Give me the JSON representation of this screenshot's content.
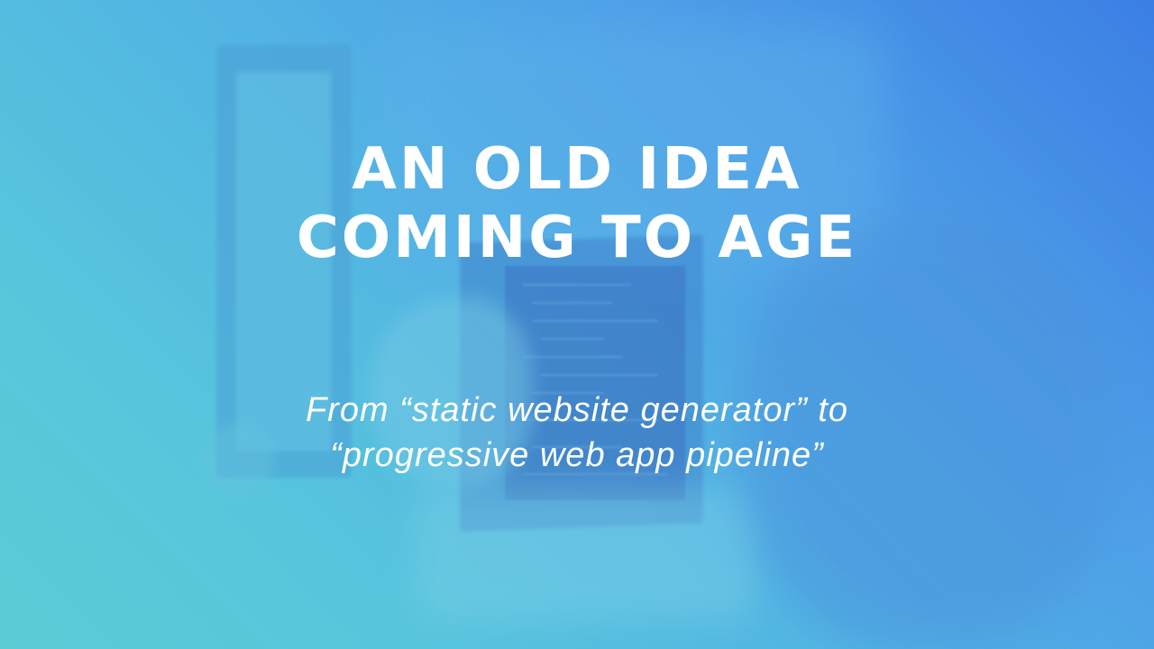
{
  "slide": {
    "title_lines": [
      "AN OLD IDEA",
      "COMING TO AGE"
    ],
    "subtitle_lines": [
      "From “static website generator” to",
      "“progressive web app pipeline”"
    ],
    "background_image": "blurred-person-pointing-at-code-monitor",
    "colors": {
      "gradient_start": "#5bcbd4",
      "gradient_end": "#3b7fe4",
      "text": "#ffffff"
    }
  }
}
